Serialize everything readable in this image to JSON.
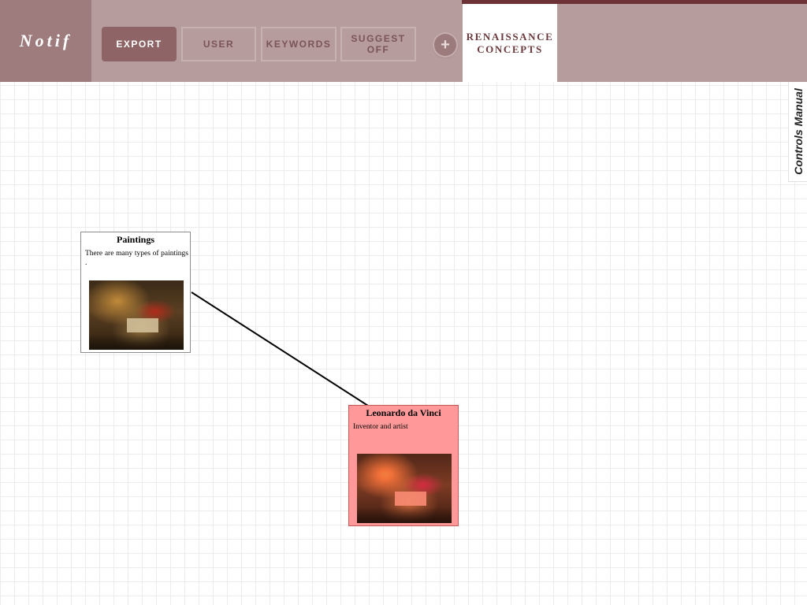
{
  "app": {
    "logo": "Notif"
  },
  "toolbar": {
    "export_label": "EXPORT",
    "user_label": "USER",
    "keywords_label": "KEYWORDS",
    "suggest_label": "SUGGEST\nOFF",
    "add_icon": "plus-icon"
  },
  "tabs": [
    {
      "label": "RENAISSANCE\nCONCEPTS",
      "active": true
    }
  ],
  "side_panel": {
    "manual_label": "Controls Manual"
  },
  "nodes": [
    {
      "title": "Paintings",
      "description": "There are many types of paintings .",
      "image": "painting-thumbnail",
      "highlighted": false
    },
    {
      "title": "Leonardo da Vinci",
      "description": "Inventor and artist",
      "image": "painting-thumbnail",
      "highlighted": true
    }
  ],
  "colors": {
    "topbar": "#b69c9c",
    "logo_block": "#9e7b7d",
    "primary_button": "#8e6466",
    "accent": "#6d3236",
    "highlight_node": "#ff9999"
  }
}
